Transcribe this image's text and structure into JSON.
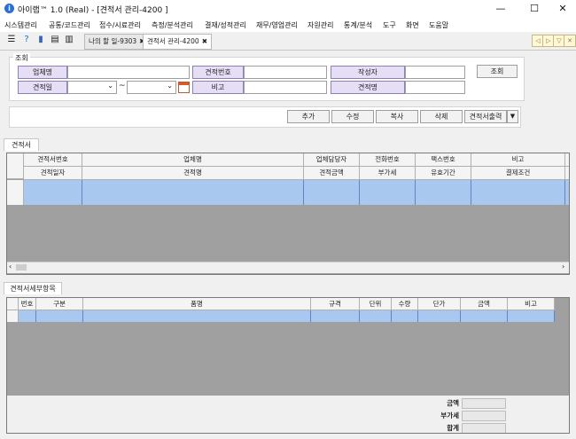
{
  "window": {
    "title": "아이랩™ 1.0 (Real) - [견적서 관리-4200 ]",
    "minimize": "—",
    "maximize": "☐",
    "close": "✕"
  },
  "menu": [
    "시스템관리",
    "공통/코드관리",
    "접수/시료관리",
    "측정/분석관리",
    "결재/성적관리",
    "재무/영업관리",
    "자원관리",
    "통계/분석",
    "도구",
    "화면",
    "도움말"
  ],
  "tabs": [
    {
      "label": "나의 할 일-9303",
      "close": "✖"
    },
    {
      "label": "견적서 관리-4200",
      "close": "✖"
    }
  ],
  "search": {
    "group_label": "조회",
    "company_label": "업체명",
    "quote_no_label": "견적번호",
    "author_label": "작성자",
    "search_button": "조회",
    "quote_date_label": "견적일",
    "date_sep": "~",
    "remark_label": "비고",
    "quote_name_label": "견적명"
  },
  "actions": [
    "추가",
    "수정",
    "복사",
    "삭제",
    "견적서출력"
  ],
  "quote_grid": {
    "section_label": "견적서",
    "headers_row1": [
      "견적서번호",
      "업체명",
      "업체담당자",
      "전화번호",
      "팩스번호",
      "비고"
    ],
    "headers_row2": [
      "견적일자",
      "견적명",
      "견적금액",
      "부가세",
      "유효기간",
      "결제조건"
    ]
  },
  "detail_grid": {
    "section_label": "견적서세부항목",
    "headers": [
      "번호",
      "구분",
      "품명",
      "규격",
      "단위",
      "수량",
      "단가",
      "금액",
      "비고"
    ]
  },
  "totals": {
    "amount_label": "금액",
    "vat_label": "부가세",
    "total_label": "합계"
  },
  "colors": {
    "accent": "#a8c8f0",
    "label_bg": "#e5def5",
    "grid_empty": "#a0a0a0"
  }
}
